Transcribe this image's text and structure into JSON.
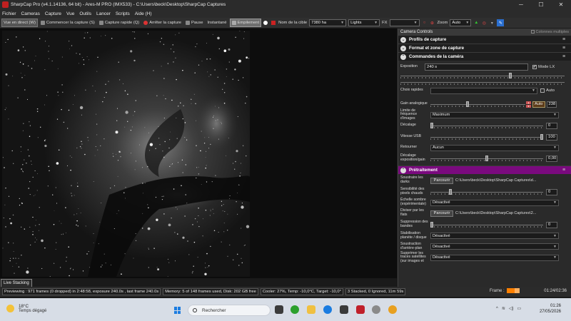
{
  "window": {
    "title": "SharpCap Pro (v4.1.14136, 64 bit) - Ares-M PRO (IMX533) - C:\\Users\\beck\\Desktop\\SharpCap Captures",
    "minimize": "─",
    "maximize": "☐",
    "close": "✕"
  },
  "menu": [
    "Fichier",
    "Cameras",
    "Capture",
    "Vue",
    "Outils",
    "Lancer",
    "Scripts",
    "Aide (H)"
  ],
  "toolbar": {
    "live_view": "Vue en direct (W)",
    "start_capture": "Commencer la capture (S)",
    "quick_capture": "Capture rapide (Q)",
    "stop_capture": "Arrêter la capture",
    "pause": "Pause",
    "snapshot": "Instantané",
    "stacking": "Empilement",
    "target_label": "Nom de la cible",
    "target_value": "7380 ha",
    "frame_type": "Lights",
    "fx_label": "FX",
    "fx_value": "",
    "zoom_label": "Zoom",
    "zoom_value": "Auto"
  },
  "panel": {
    "header": "Camera Controls",
    "multi_columns": "Colonnes multiples",
    "sections": {
      "profiles": "Profils de capture",
      "format": "Format et zone de capture",
      "camera_controls": "Commandes de la caméra",
      "processing": "Prétraitement"
    },
    "exposure": {
      "label": "Exposition",
      "value": "240 s",
      "lx_label": "Mode LX",
      "lx_checked": "✔"
    },
    "quick_picks": {
      "label": "Choix rapides",
      "value": "",
      "auto_label": "Auto"
    },
    "gain": {
      "label": "Gain analogique",
      "auto": "Auto",
      "value": "238"
    },
    "frame_rate_limit": {
      "label": "Limite de fréquence d'images",
      "value": "Maximum"
    },
    "offset": {
      "label": "Décalage",
      "value": "0"
    },
    "usb_speed": {
      "label": "Vitesse USB",
      "value": "100"
    },
    "flip": {
      "label": "Retourner",
      "value": "Aucun"
    },
    "offset_exposure_gain": {
      "label": "Décalage exposition/gain",
      "value": "0,00"
    },
    "subtract_darks": {
      "label": "Soustraire les darks",
      "browse": "Parcourir",
      "path": "C:\\Users\\beck\\Desktop\\SharpCap Captures\\d..."
    },
    "hot_pixel": {
      "label": "Sensibilité des pixels chauds",
      "value": "0"
    },
    "dark_scale": {
      "label": "Échelle sombre (expérimentale)",
      "value": "Désactivé"
    },
    "divide_flats": {
      "label": "Diviser par les flats",
      "browse": "Parcourir",
      "path": "C:\\Users\\beck\\Desktop\\SharpCap Captures\\2..."
    },
    "banding": {
      "label": "Suppression des bandes",
      "value": "0"
    },
    "planet_stab": {
      "label": "Stabilisation planète / disque",
      "value": "Désactivé"
    },
    "bg_subtract": {
      "label": "Soustraction d'arrière-plan",
      "value": "Désactivé"
    },
    "sat_trails": {
      "label": "Supprimer les traces satellites (sur images et",
      "value": "Désactivé"
    }
  },
  "live_stacking_tab": "Live Stacking",
  "status": {
    "preview": "Previewing : 971 frames (0 dropped) in 2:48:58, exposure 240.0s , last frame 240.0s",
    "memory": "Memory: 5 of 148 frames used, Disk: 202 GB free",
    "cooler": "Cooler: 27%, Temp: -10,0°C, Target: -10,0°",
    "stacked": "3 Stacked, 0 Ignored, 11m 59s",
    "frame_label": "Frame :",
    "elapsed": "01:24/02:36",
    "frame_progress": 0.6
  },
  "taskbar": {
    "temperature": "18°C",
    "condition": "Temps dégagé",
    "search_placeholder": "Rechercher",
    "time": "01:26",
    "date": "27/05/2026",
    "tray_chevron": "^"
  },
  "colors": {
    "section_purple": "#7a0a7e",
    "frame_bar": "#ff8000",
    "accent_blue": "#1b7ce0"
  }
}
